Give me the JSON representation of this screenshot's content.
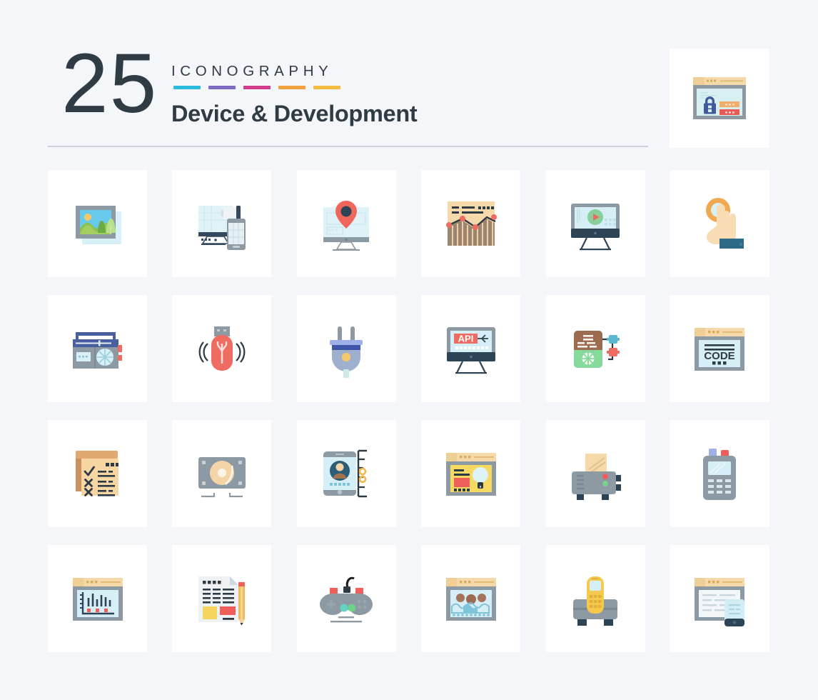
{
  "header": {
    "number": "25",
    "kicker": "ICONOGRAPHY",
    "title": "Device & Development",
    "accent_bars": [
      "#2cbcdf",
      "#7f6bc4",
      "#d33d8b",
      "#f2a03d",
      "#f5bb42"
    ],
    "text_color": "#2f3c46",
    "rule_color": "#c9d2dd"
  },
  "page": {
    "background": "#f4f6f9",
    "card_background": "#ffffff",
    "icon_count": 25,
    "grid_columns": 6,
    "grid_rows": 4
  },
  "feature_icon": {
    "name": "browser-password-lock-icon",
    "label": "Browser window with padlock and password fields"
  },
  "icons": [
    {
      "name": "picture-frame-icon",
      "label": "Image / picture frame"
    },
    {
      "name": "desktop-mobile-sync-icon",
      "label": "Desktop computer and mobile phone"
    },
    {
      "name": "monitor-location-pin-icon",
      "label": "Monitor with map location pin"
    },
    {
      "name": "analytics-chart-icon",
      "label": "Analytics line and bar chart"
    },
    {
      "name": "monitor-video-play-icon",
      "label": "Monitor with video play button"
    },
    {
      "name": "touch-click-hand-icon",
      "label": "Hand touch / click gesture"
    },
    {
      "name": "radio-icon",
      "label": "Portable radio receiver"
    },
    {
      "name": "usb-flash-drive-icon",
      "label": "USB flash drive with signal waves"
    },
    {
      "name": "power-plug-icon",
      "label": "Electric power plug"
    },
    {
      "name": "monitor-api-icon",
      "label": "Monitor displaying API"
    },
    {
      "name": "server-network-icon",
      "label": "Server device with network nodes"
    },
    {
      "name": "browser-code-icon",
      "label": "Browser window showing CODE"
    },
    {
      "name": "checklist-document-icon",
      "label": "Checklist scroll document"
    },
    {
      "name": "hard-disk-drive-icon",
      "label": "Hard disk drive platter"
    },
    {
      "name": "mobile-user-profile-icon",
      "label": "Mobile phone user profile with ruler"
    },
    {
      "name": "browser-idea-bulb-icon",
      "label": "Browser window with light bulb idea"
    },
    {
      "name": "toaster-icon",
      "label": "Toaster with bread slice"
    },
    {
      "name": "pos-calculator-icon",
      "label": "POS terminal / calculator device"
    },
    {
      "name": "browser-bar-graph-icon",
      "label": "Browser window with bar graph"
    },
    {
      "name": "document-pencil-icon",
      "label": "Document with pencil"
    },
    {
      "name": "game-controller-icon",
      "label": "Game controller joypad"
    },
    {
      "name": "browser-team-photo-icon",
      "label": "Browser window with team photo"
    },
    {
      "name": "cordless-telephone-icon",
      "label": "Cordless telephone on base"
    },
    {
      "name": "browser-mobile-sync-icon",
      "label": "Browser window with mobile phone"
    }
  ]
}
